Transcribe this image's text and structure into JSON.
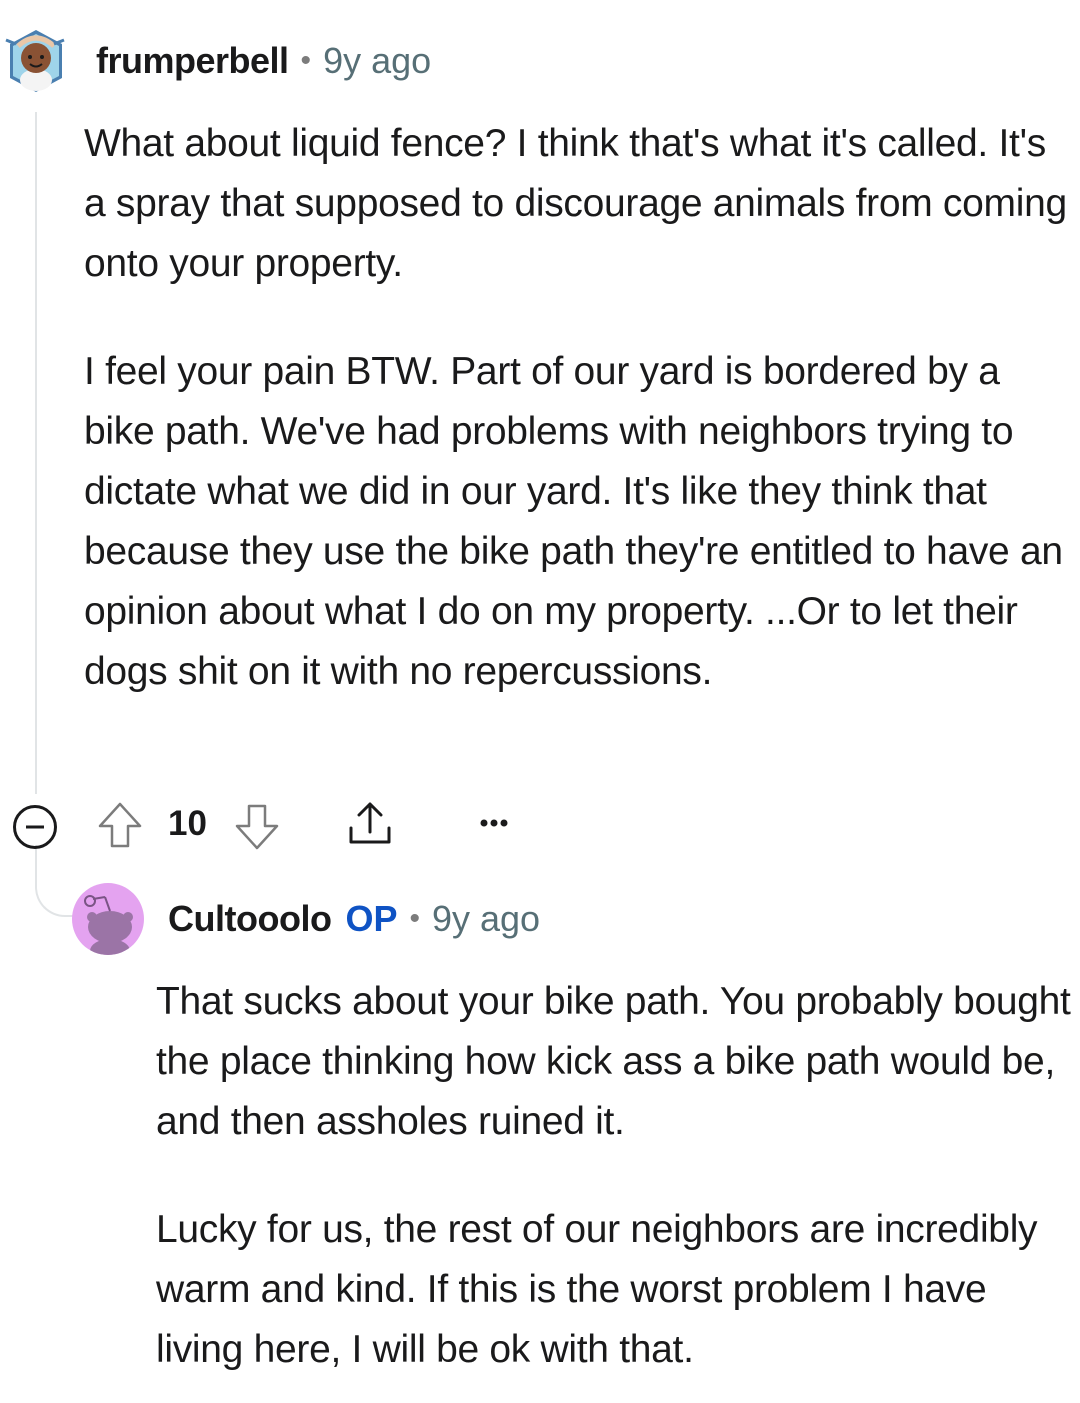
{
  "comment": {
    "username": "frumperbell",
    "time": "9y ago",
    "avatar_icon": "snoo-avatar-icon",
    "paragraphs": [
      "What about liquid fence? I think that's what it's called. It's a spray that supposed to discourage animals from coming onto your property.",
      "I feel your pain BTW. Part of our yard is bordered by a bike path. We've had problems with neighbors trying to dictate what we did in our yard. It's like they think that because they use the bike path they're entitled to have an opinion about what I do on my property. ...Or to let their dogs shit on it with no repercussions."
    ],
    "actions": {
      "score": "10",
      "collapse_icon": "collapse-minus-icon",
      "upvote_icon": "arrow-up-icon",
      "downvote_icon": "arrow-down-icon",
      "share_icon": "share-icon",
      "more_icon": "ellipsis-icon"
    }
  },
  "reply": {
    "username": "Cultooolo",
    "op_badge": "OP",
    "time": "9y ago",
    "avatar_icon": "default-snoo-avatar-icon",
    "paragraphs": [
      "That sucks about your bike path. You probably bought the place thinking how kick ass a bike path would be, and then assholes ruined it.",
      "Lucky for us, the rest of our neighbors are incredibly warm and kind. If this is the worst problem I have living here, I will be ok with that."
    ]
  },
  "colors": {
    "op_badge": "#0f53c4",
    "thread_line": "#e1e4e6",
    "avatar_bg": "#e4a3f0",
    "meta_text": "#576f76"
  },
  "separator": "•"
}
